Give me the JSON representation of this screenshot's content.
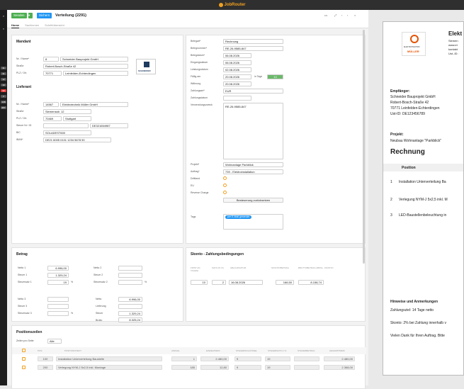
{
  "app": {
    "name": "JobRouter"
  },
  "header": {
    "send_label": "Senden",
    "save_label": "Sichern",
    "title": "Verteilung (2291)",
    "tabs": [
      "Home",
      "Sachinmen",
      "Schrittübersicht"
    ]
  },
  "mandant": {
    "title": "Mandant",
    "nr_label": "Nr. / Name*",
    "nr": "8",
    "name": "Schneider Bauprojekt GmbH",
    "strasse_label": "Straße",
    "strasse": "Robert-Bosch-Straße 42",
    "plz_label": "PLZ / Ort.",
    "plz": "70771",
    "ort": "Leinfelden-Echterdingen",
    "logo_text": "SCHNEIDER"
  },
  "lieferant": {
    "title": "Lieferant",
    "nr_label": "Nr. / Name*",
    "nr": "14567",
    "name": "Elektrotechnik Müller GmbH",
    "strasse_label": "Straße",
    "strasse": "Siemensstr. 12",
    "plz_label": "PLZ / Ort.",
    "plz": "70469",
    "ort": "Stuttgart",
    "steuer_label": "Steuer Nr / ID",
    "steuer": "DE321654987",
    "bic_label": "BIC",
    "bic": "SOLADEST600",
    "iban_label": "IBAN*",
    "iban": "DE21 6005 0101 1234 5678 90"
  },
  "beleg": {
    "belegart_label": "Belegart*",
    "belegart": "Rechnung",
    "belegnummer_label": "Belegnummer*",
    "belegnummer": "RE-26-9585-847",
    "belegdatum_label": "Belegdatum*",
    "belegdatum": "06.08.2026",
    "eingang_label": "Eingangsdatum",
    "eingang": "06.08.2026",
    "leistung_label": "Leistungsdatum",
    "leistung": "02.08.2026",
    "faellig_label": "Fällig am",
    "faellig": "20.08.2026",
    "in_tage": "in Tage",
    "tage": "14",
    "waehrung_label": "Währung",
    "waehrung": "20.08.2026",
    "zahlungsart_label": "Zahlungsart*",
    "zahlungsart": "EUR",
    "zahlungsdatum_label": "Zahlungsdatum",
    "verwendung_label": "Verwendungszweck",
    "verwendung": "RE-26-9585-847",
    "projekt_label": "Projekt*",
    "projekt": "Wohnanlage Parkblick",
    "auftrag_label": "Auftrag*",
    "auftrag": "739 - Elektroinstallation",
    "dritt_label": "Drittland",
    "eu_label": "EU",
    "reverse_label": "Reverse Charge",
    "besteuerung_btn": "Besteuerung zurücksetzen",
    "tags_label": "Tags",
    "tag": "per E-Mail gesendet"
  },
  "betrag": {
    "title": "Betrag",
    "netto1_label": "Netto 1",
    "netto1": "6.996,00",
    "steuer1_label": "Steuer 1",
    "steuer1": "1.329,24",
    "satz1_label": "Steuersatz 1",
    "satz1": "19",
    "pct": "%",
    "netto2_label": "Netto 2",
    "steuer2_label": "Steuer 2",
    "satz2_label": "Steuersatz 2",
    "netto3_label": "Netto 3",
    "steuer3_label": "Steuer 3",
    "satz3_label": "Steuersatz 3",
    "netto_label": "Netto",
    "netto": "6.996,00",
    "lieferung_label": "Lieferung",
    "steuer_label": "Steuer",
    "steuer": "1.329,24",
    "brutto_label": "Brutto",
    "brutto": "8.325,24"
  },
  "skonto": {
    "title": "Skonto - Zahlungsbedingungen",
    "cols": [
      "FRIST (IN TAGEN)",
      "SATZ (IN %)",
      "ABLAUFDATUM",
      "SKONTOBETRAG",
      "BRUTTOBETRAG ABZGL. SKONTO"
    ],
    "frist": "10",
    "satz": "2",
    "datum": "16.08.2026",
    "betrag": "166,50",
    "brutto": "8.158,74"
  },
  "positionen": {
    "title": "Positionszeilen",
    "per_page_label": "Zeilen pro Seite",
    "per_page": "Alle",
    "cols": [
      "POS.",
      "POSITIONSTEXT",
      "ANZAHL",
      "EINZELPREIS",
      "STEUERSCHLÜSSEL",
      "STEUERSATZ in %",
      "STEUERBETRAG",
      "GESAMTPREIS"
    ],
    "rows": [
      {
        "pos": "100",
        "text": "Installation Unterverteilung Baustelle",
        "anzahl": "1",
        "preis": "2.480,00",
        "schluessel": "9",
        "satz": "19",
        "gesamt": "2.480,00"
      },
      {
        "pos": "200",
        "text": "Verlegung NYM-J 5x2,5 inkl. Montage",
        "anzahl": "185",
        "preis": "12,80",
        "schluessel": "9",
        "satz": "19",
        "gesamt": "2.368,00"
      }
    ]
  },
  "document": {
    "company": "Elekt",
    "line1": "Siemen",
    "line2": "www.el",
    "line3": "kontakt",
    "line4": "Ust.-ID:",
    "logo_line1": "ELEKTROTECHNIK",
    "logo_line2": "MÜLLER",
    "empf_label": "Empfänger:",
    "empf1": "Schneider Bauprojekt GmbH",
    "empf2": "Robert-Bosch-Straße 42",
    "empf3": "70771 Leinfelden-Echterdingen",
    "empf4": "Ust-ID: DE123456789",
    "projekt_label": "Projekt:",
    "projekt": "Neubau Wohnanlage \"Parkblick\"",
    "heading": "Rechnung",
    "pos_col": "Position",
    "items": [
      {
        "n": "1",
        "t": "Installation Unterverteilung Ba"
      },
      {
        "n": "2",
        "t": "Verlegung NYM-J 5x2,5 inkl. M"
      },
      {
        "n": "3",
        "t": "LED-Baustellenbeleuchtung in"
      }
    ],
    "hinweise_label": "Hinweise und Anmerkungen",
    "zahlungsziel": "Zahlungsziel: 14 Tage netto",
    "skonto_text": "Skonto: 2% bei Zahlung innerhalb v",
    "dank": "Vielen Dank für Ihren Auftrag. Bitte"
  }
}
